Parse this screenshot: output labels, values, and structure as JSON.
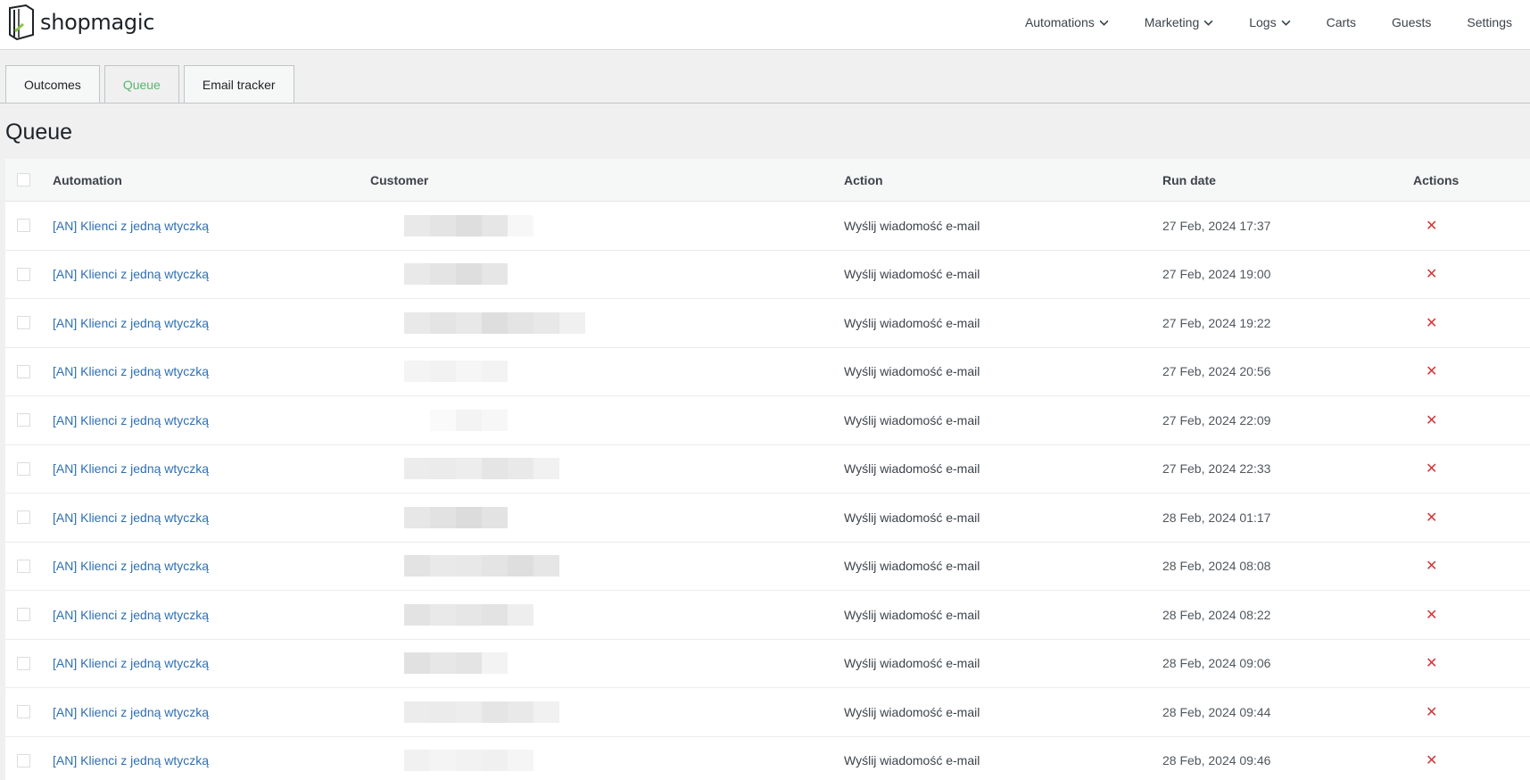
{
  "brand": {
    "name": "shopmagic"
  },
  "nav": {
    "items": [
      {
        "label": "Automations",
        "dropdown": true
      },
      {
        "label": "Marketing",
        "dropdown": true
      },
      {
        "label": "Logs",
        "dropdown": true
      },
      {
        "label": "Carts",
        "dropdown": false
      },
      {
        "label": "Guests",
        "dropdown": false
      },
      {
        "label": "Settings",
        "dropdown": false
      }
    ]
  },
  "tabs": [
    {
      "label": "Outcomes",
      "active": false
    },
    {
      "label": "Queue",
      "active": true
    },
    {
      "label": "Email tracker",
      "active": false
    }
  ],
  "page": {
    "title": "Queue"
  },
  "table": {
    "columns": {
      "automation": "Automation",
      "customer": "Customer",
      "action": "Action",
      "run_date": "Run date",
      "actions": "Actions"
    },
    "rows": [
      {
        "automation": "[AN] Klienci z jedną wtyczką",
        "action": "Wyślij wiadomość e-mail",
        "run_date": "27 Feb, 2024 17:37"
      },
      {
        "automation": "[AN] Klienci z jedną wtyczką",
        "action": "Wyślij wiadomość e-mail",
        "run_date": "27 Feb, 2024 19:00"
      },
      {
        "automation": "[AN] Klienci z jedną wtyczką",
        "action": "Wyślij wiadomość e-mail",
        "run_date": "27 Feb, 2024 19:22"
      },
      {
        "automation": "[AN] Klienci z jedną wtyczką",
        "action": "Wyślij wiadomość e-mail",
        "run_date": "27 Feb, 2024 20:56"
      },
      {
        "automation": "[AN] Klienci z jedną wtyczką",
        "action": "Wyślij wiadomość e-mail",
        "run_date": "27 Feb, 2024 22:09"
      },
      {
        "automation": "[AN] Klienci z jedną wtyczką",
        "action": "Wyślij wiadomość e-mail",
        "run_date": "27 Feb, 2024 22:33"
      },
      {
        "automation": "[AN] Klienci z jedną wtyczką",
        "action": "Wyślij wiadomość e-mail",
        "run_date": "28 Feb, 2024 01:17"
      },
      {
        "automation": "[AN] Klienci z jedną wtyczką",
        "action": "Wyślij wiadomość e-mail",
        "run_date": "28 Feb, 2024 08:08"
      },
      {
        "automation": "[AN] Klienci z jedną wtyczką",
        "action": "Wyślij wiadomość e-mail",
        "run_date": "28 Feb, 2024 08:22"
      },
      {
        "automation": "[AN] Klienci z jedną wtyczką",
        "action": "Wyślij wiadomość e-mail",
        "run_date": "28 Feb, 2024 09:06"
      },
      {
        "automation": "[AN] Klienci z jedną wtyczką",
        "action": "Wyślij wiadomość e-mail",
        "run_date": "28 Feb, 2024 09:44"
      },
      {
        "automation": "[AN] Klienci z jedną wtyczką",
        "action": "Wyślij wiadomość e-mail",
        "run_date": "28 Feb, 2024 09:46"
      }
    ]
  },
  "colors": {
    "accent": "#5ab56e",
    "link": "#2e6fb2",
    "delete": "#d63638"
  },
  "icons": {
    "logo": "shopmagic-logo-icon",
    "dropdown": "chevron-down-icon",
    "sort": "sort-arrow-down-icon",
    "delete": "close-icon"
  }
}
